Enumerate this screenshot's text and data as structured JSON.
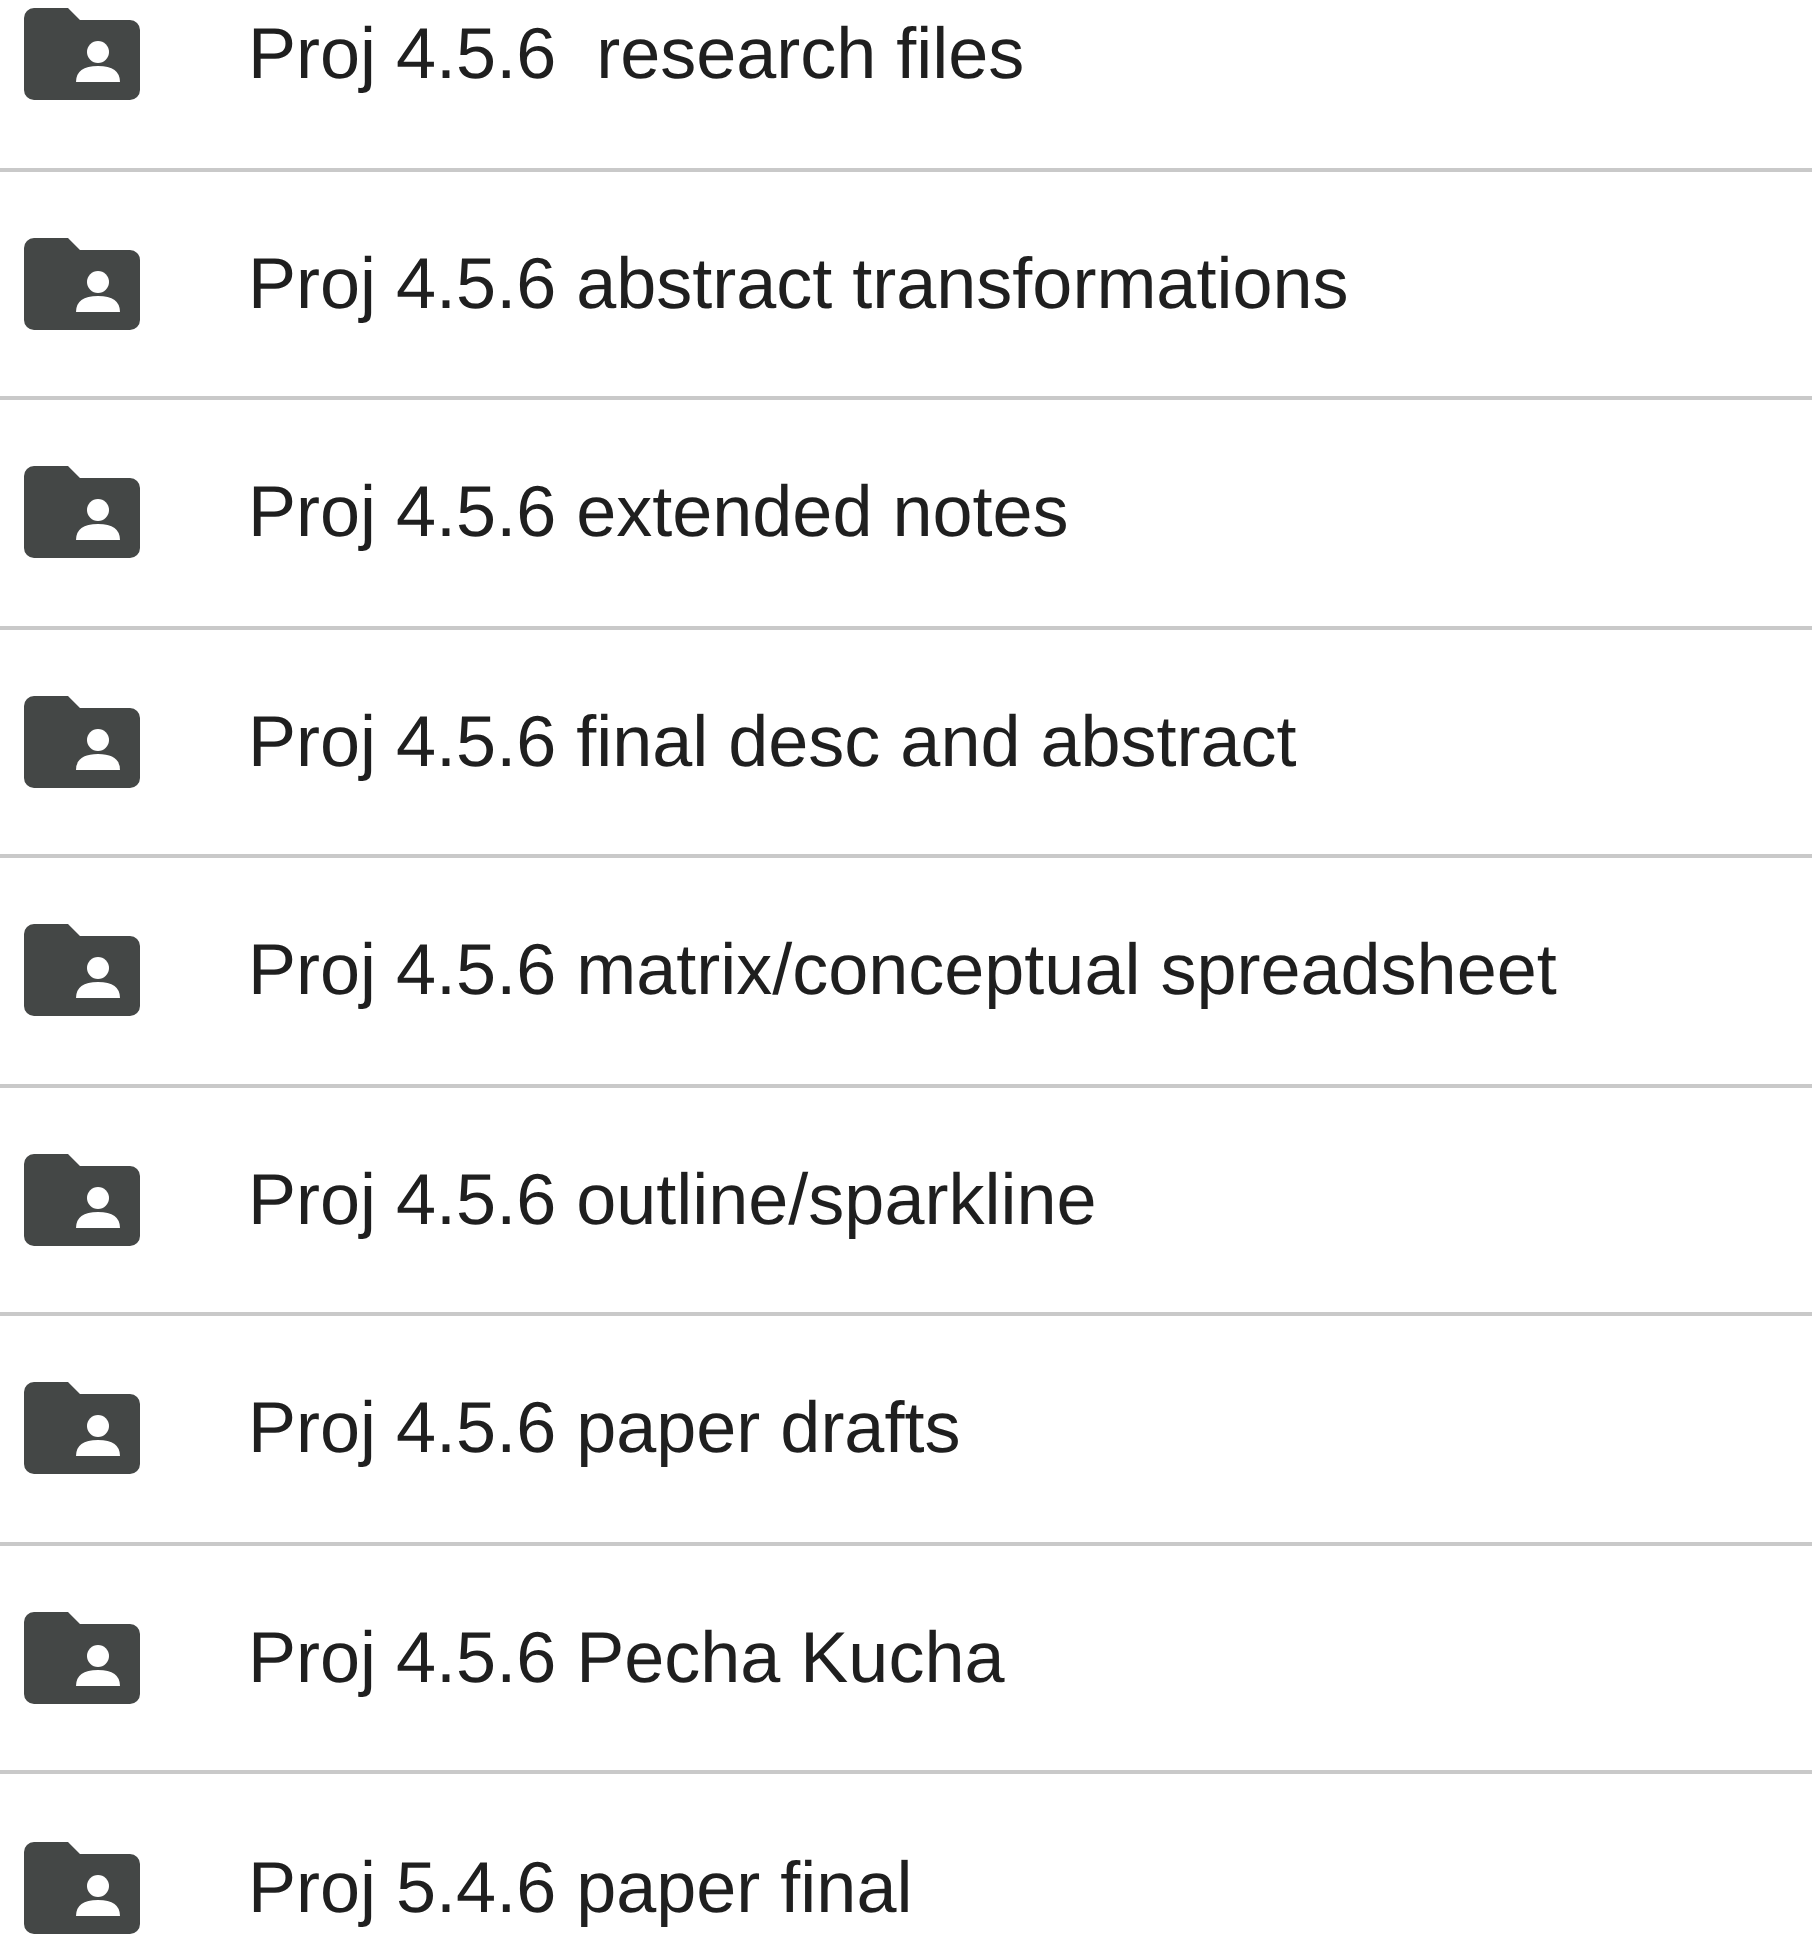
{
  "folders": [
    {
      "name": "Proj 4.5.6  research files"
    },
    {
      "name": "Proj 4.5.6 abstract transformations"
    },
    {
      "name": "Proj 4.5.6 extended notes"
    },
    {
      "name": "Proj 4.5.6 final desc and abstract"
    },
    {
      "name": "Proj 4.5.6 matrix/conceptual spreadsheet"
    },
    {
      "name": "Proj 4.5.6 outline/sparkline"
    },
    {
      "name": "Proj 4.5.6 paper drafts"
    },
    {
      "name": "Proj 4.5.6 Pecha Kucha"
    },
    {
      "name": "Proj 5.4.6 paper final"
    }
  ]
}
